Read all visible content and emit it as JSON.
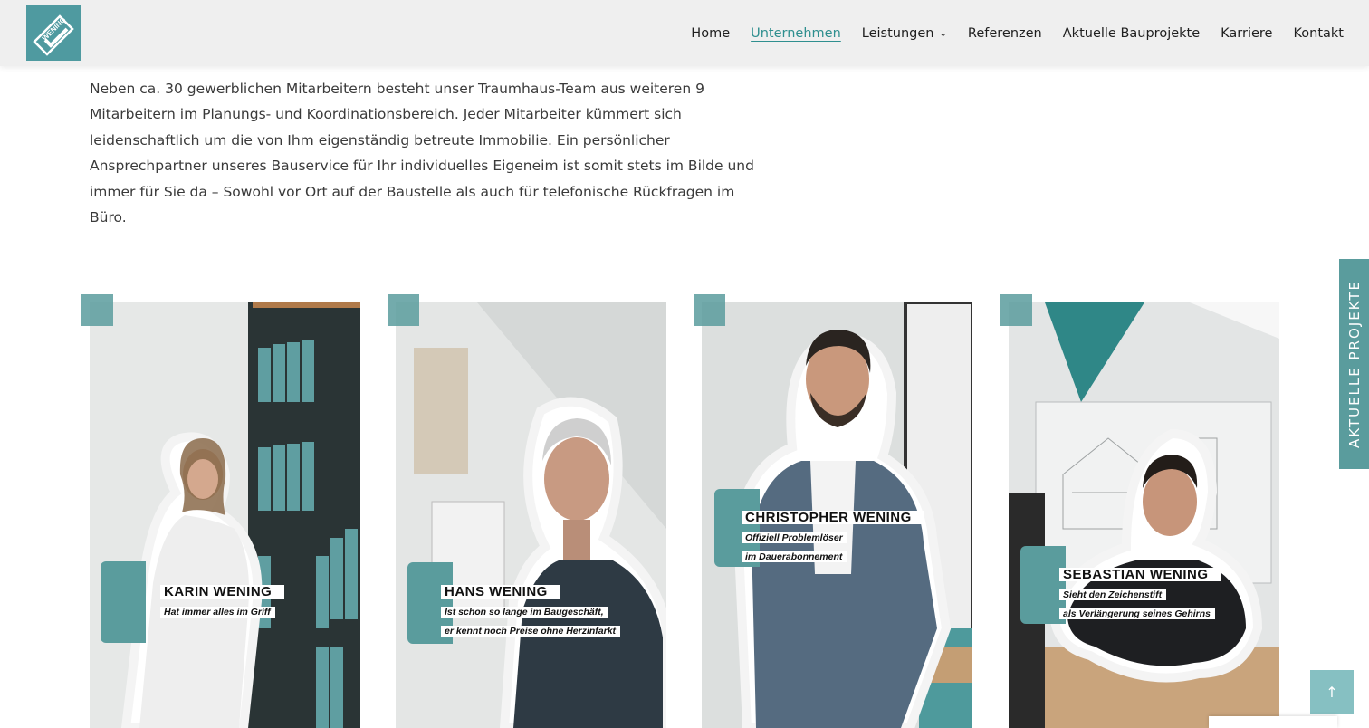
{
  "header": {
    "logo_text": "WENING BAU",
    "nav": [
      {
        "label": "Home"
      },
      {
        "label": "Unternehmen",
        "active": true
      },
      {
        "label": "Leistungen",
        "has_dropdown": true
      },
      {
        "label": "Referenzen"
      },
      {
        "label": "Aktuelle Bauprojekte"
      },
      {
        "label": "Karriere"
      },
      {
        "label": "Kontakt"
      }
    ]
  },
  "intro": {
    "text": "Neben ca. 30 gewerblichen Mitarbeitern besteht unser Traumhaus-Team aus weiteren 9 Mitarbeitern im Planungs- und Koordinationsbereich. Jeder Mitarbeiter kümmert sich leidenschaftlich um die von Ihm eigenständig betreute Immobilie. Ein persönlicher Ansprechpartner unseres Bauservice für Ihr individuelles Eigeneim ist somit stets im Bilde und immer für Sie da – Sowohl vor Ort auf der Baustelle als auch für telefonische Rückfragen im Büro."
  },
  "team": [
    {
      "name": "KARIN WENING",
      "sub": [
        "Hat immer alles im Griff"
      ]
    },
    {
      "name": "HANS WENING",
      "sub": [
        "Ist schon so lange im Baugeschäft,",
        "er kennt noch Preise ohne Herzinfarkt"
      ]
    },
    {
      "name": "CHRISTOPHER WENING",
      "sub": [
        "Offiziell Problemlöser",
        "im Dauerabonnement"
      ]
    },
    {
      "name": "SEBASTIAN WENING",
      "sub": [
        "Sieht den Zeichenstift",
        "als Verlängerung seines Gehirns"
      ]
    }
  ],
  "side_tab": {
    "label": "AKTUELLE PROJEKTE"
  },
  "back_to_top": {
    "icon": "arrow-up-icon",
    "glyph": "↑"
  },
  "colors": {
    "accent": "#5a9c9d",
    "nav_active": "#2f8f8f",
    "header_bg": "#efefef"
  }
}
